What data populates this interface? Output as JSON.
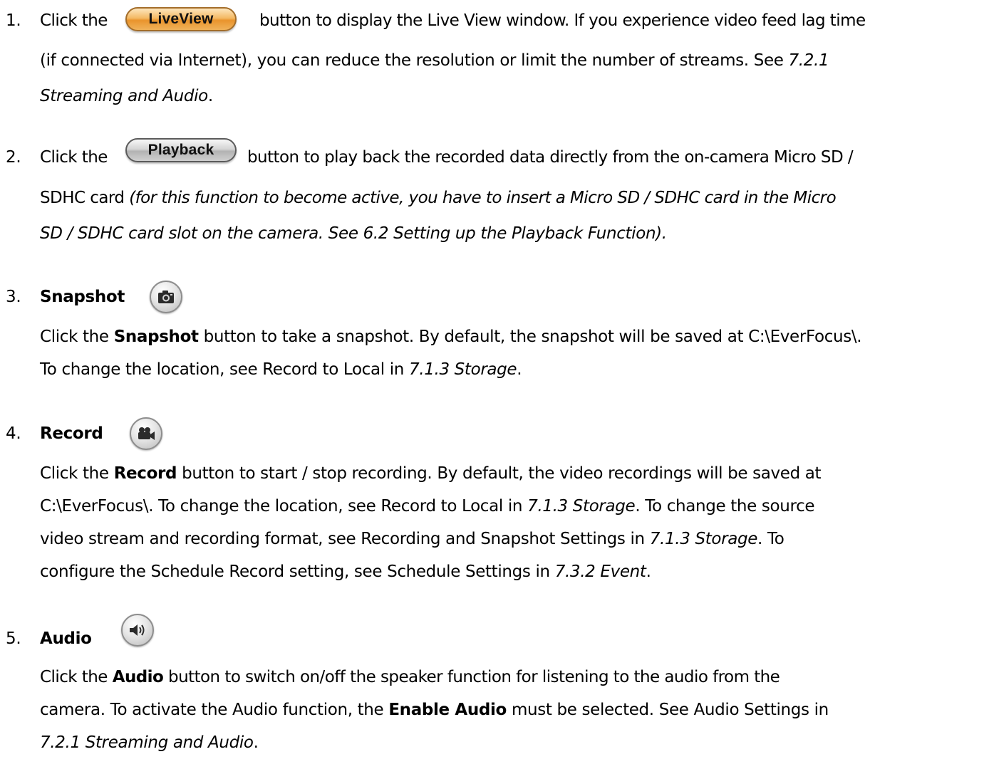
{
  "items": [
    {
      "number": "1.",
      "lines": [
        {
          "parts": [
            {
              "t": "Click the "
            }
          ],
          "after_button": [
            {
              "t": "button to display the Live View window. If you experience video feed lag time"
            }
          ]
        },
        {
          "parts": [
            {
              "t": "(if connected via Internet), you can reduce the resolution or limit the number of streams. See "
            },
            {
              "t": "7.2.1",
              "s": "i"
            }
          ]
        },
        {
          "parts": [
            {
              "t": "Streaming and Audio",
              "s": "i"
            },
            {
              "t": "."
            }
          ]
        }
      ],
      "button_label": "LiveView"
    },
    {
      "number": "2.",
      "lines": [
        {
          "parts": [
            {
              "t": "Click the "
            }
          ],
          "after_button": [
            {
              "t": "button to play back the recorded data directly from the on-camera Micro SD /"
            }
          ]
        },
        {
          "parts": [
            {
              "t": "SDHC card "
            },
            {
              "t": "(for this function to become active, you have to insert a Micro SD / SDHC card in the Micro",
              "s": "i"
            }
          ]
        },
        {
          "parts": [
            {
              "t": "SD / SDHC card slot on the camera. See 6.2 Setting up the Playback Function).",
              "s": "i"
            }
          ]
        }
      ],
      "button_label": "Playback"
    },
    {
      "number": "3.",
      "title": "Snapshot",
      "icon": "camera-icon",
      "lines": [
        {
          "parts": [
            {
              "t": "Click the "
            },
            {
              "t": "Snapshot",
              "s": "b"
            },
            {
              "t": " button to take a snapshot. By default, the snapshot will be saved at C:\\EverFocus\\."
            }
          ]
        },
        {
          "parts": [
            {
              "t": "To change the location, see Record to Local in "
            },
            {
              "t": "7.1.3 Storage",
              "s": "i"
            },
            {
              "t": "."
            }
          ]
        }
      ]
    },
    {
      "number": "4.",
      "title": "Record",
      "icon": "video-camera-icon",
      "lines": [
        {
          "parts": [
            {
              "t": "Click the "
            },
            {
              "t": "Record",
              "s": "b"
            },
            {
              "t": " button to start / stop recording. By default, the video recordings will be saved at"
            }
          ]
        },
        {
          "parts": [
            {
              "t": "C:\\EverFocus\\. To change the location, see Record to Local in "
            },
            {
              "t": "7.1.3 Storage",
              "s": "i"
            },
            {
              "t": ". To change the source"
            }
          ]
        },
        {
          "parts": [
            {
              "t": "video stream and recording format, see Recording and Snapshot Settings in "
            },
            {
              "t": "7.1.3 Storage",
              "s": "i"
            },
            {
              "t": ". To"
            }
          ]
        },
        {
          "parts": [
            {
              "t": "configure the Schedule Record setting, see Schedule Settings in "
            },
            {
              "t": "7.3.2 Event",
              "s": "i"
            },
            {
              "t": "."
            }
          ]
        }
      ]
    },
    {
      "number": "5.",
      "title": "Audio",
      "icon": "speaker-icon",
      "lines": [
        {
          "parts": [
            {
              "t": "Click the "
            },
            {
              "t": "Audio",
              "s": "b"
            },
            {
              "t": " button to switch on/off the speaker function for listening to the audio from the"
            }
          ]
        },
        {
          "parts": [
            {
              "t": "camera. To activate the Audio function, the "
            },
            {
              "t": "Enable Audio",
              "s": "b"
            },
            {
              "t": " must be selected. See Audio Settings in"
            }
          ]
        },
        {
          "parts": [
            {
              "t": "7.2.1 Streaming and Audio",
              "s": "i"
            },
            {
              "t": "."
            }
          ]
        }
      ]
    }
  ]
}
